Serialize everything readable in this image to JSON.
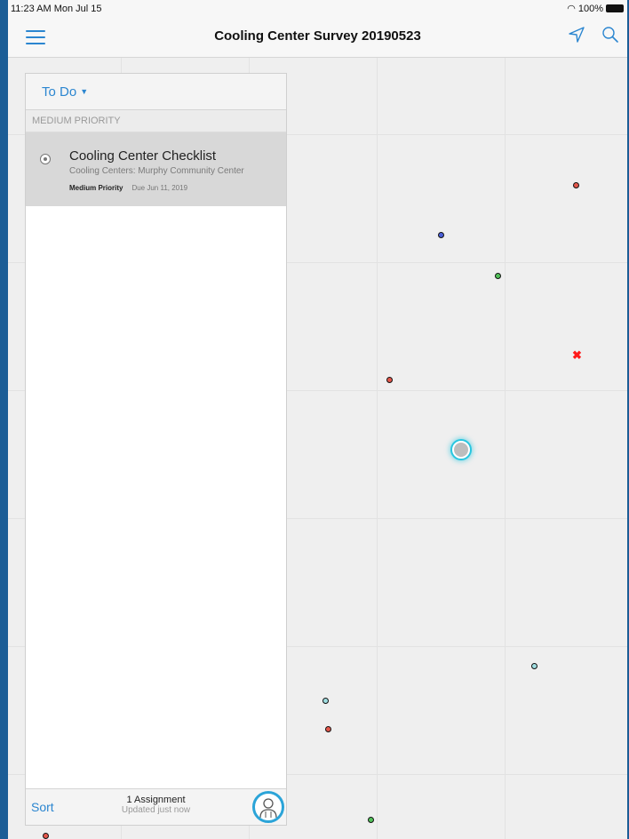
{
  "status_bar": {
    "time": "11:23 AM  Mon Jul 15",
    "battery": "100%"
  },
  "navbar": {
    "title": "Cooling Center Survey 20190523",
    "menu_icon": "hamburger-menu-icon",
    "location_icon": "navigation-arrow-icon",
    "search_icon": "search-icon"
  },
  "panel": {
    "filter_label": "To Do",
    "section_header": "MEDIUM PRIORITY",
    "assignments": [
      {
        "title": "Cooling Center Checklist",
        "subtitle": "Cooling Centers: Murphy Community Center",
        "priority": "Medium Priority",
        "due": "Due Jun 11, 2019"
      }
    ],
    "footer": {
      "sort_label": "Sort",
      "count_label": "1 Assignment",
      "updated_label": "Updated just now"
    }
  },
  "colors": {
    "accent": "#2b86d0",
    "frame": "#1b5d96",
    "point_red": "#e4574b",
    "point_blue": "#4a5fd8",
    "point_green": "#52c15a",
    "point_teal": "#9fdde0",
    "location_glow": "#29c6df"
  }
}
